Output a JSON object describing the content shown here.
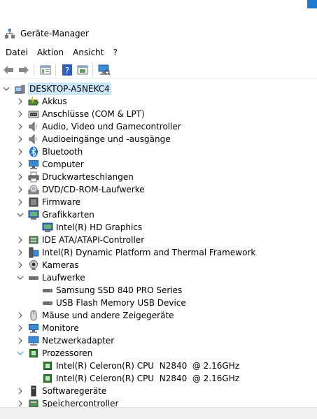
{
  "window": {
    "title": "Geräte-Manager"
  },
  "menu": [
    "Datei",
    "Aktion",
    "Ansicht",
    "?"
  ],
  "toolbar": {
    "buttons": [
      "back-arrow-icon",
      "forward-arrow-icon",
      "properties-icon",
      "help-icon",
      "update-driver-icon",
      "scan-hardware-icon"
    ]
  },
  "tree": {
    "root": "DESKTOP-A5NEKC4",
    "items": [
      {
        "label": "Akkus",
        "icon": "battery-icon",
        "expanded": false
      },
      {
        "label": "Anschlüsse (COM & LPT)",
        "icon": "port-icon",
        "expanded": false
      },
      {
        "label": "Audio, Video und Gamecontroller",
        "icon": "speaker-icon",
        "expanded": false
      },
      {
        "label": "Audioeingänge und -ausgänge",
        "icon": "speaker-icon",
        "expanded": false
      },
      {
        "label": "Bluetooth",
        "icon": "bluetooth-icon",
        "expanded": false
      },
      {
        "label": "Computer",
        "icon": "monitor-icon",
        "expanded": false
      },
      {
        "label": "Druckwarteschlangen",
        "icon": "printer-icon",
        "expanded": false
      },
      {
        "label": "DVD/CD-ROM-Laufwerke",
        "icon": "disc-icon",
        "expanded": false
      },
      {
        "label": "Firmware",
        "icon": "firmware-icon",
        "expanded": false
      },
      {
        "label": "Grafikkarten",
        "icon": "display-adapter-icon",
        "expanded": true
      },
      {
        "label": "Intel(R) HD Graphics",
        "icon": "display-adapter-icon",
        "child": true
      },
      {
        "label": "IDE ATA/ATAPI-Controller",
        "icon": "controller-icon",
        "expanded": false
      },
      {
        "label": "Intel(R) Dynamic Platform and Thermal Framework",
        "icon": "platform-icon",
        "expanded": false
      },
      {
        "label": "Kameras",
        "icon": "camera-icon",
        "expanded": false
      },
      {
        "label": "Laufwerke",
        "icon": "drive-icon",
        "expanded": true
      },
      {
        "label": "Samsung SSD 840 PRO Series",
        "icon": "drive-icon",
        "child": true
      },
      {
        "label": "USB Flash Memory USB Device",
        "icon": "drive-icon",
        "child": true
      },
      {
        "label": "Mäuse und andere Zeigegeräte",
        "icon": "mouse-icon",
        "expanded": false
      },
      {
        "label": "Monitore",
        "icon": "monitor-icon",
        "expanded": false
      },
      {
        "label": "Netzwerkadapter",
        "icon": "network-icon",
        "expanded": false
      },
      {
        "label": "Prozessoren",
        "icon": "processor-icon",
        "expanded": true
      },
      {
        "label": "Intel(R) Celeron(R) CPU  N2840  @ 2.16GHz",
        "icon": "processor-icon",
        "child": true
      },
      {
        "label": "Intel(R) Celeron(R) CPU  N2840  @ 2.16GHz",
        "icon": "processor-icon",
        "child": true
      },
      {
        "label": "Softwaregeräte",
        "icon": "software-device-icon",
        "expanded": false
      },
      {
        "label": "Speichercontroller",
        "icon": "storage-controller-icon",
        "expanded": false
      }
    ]
  }
}
